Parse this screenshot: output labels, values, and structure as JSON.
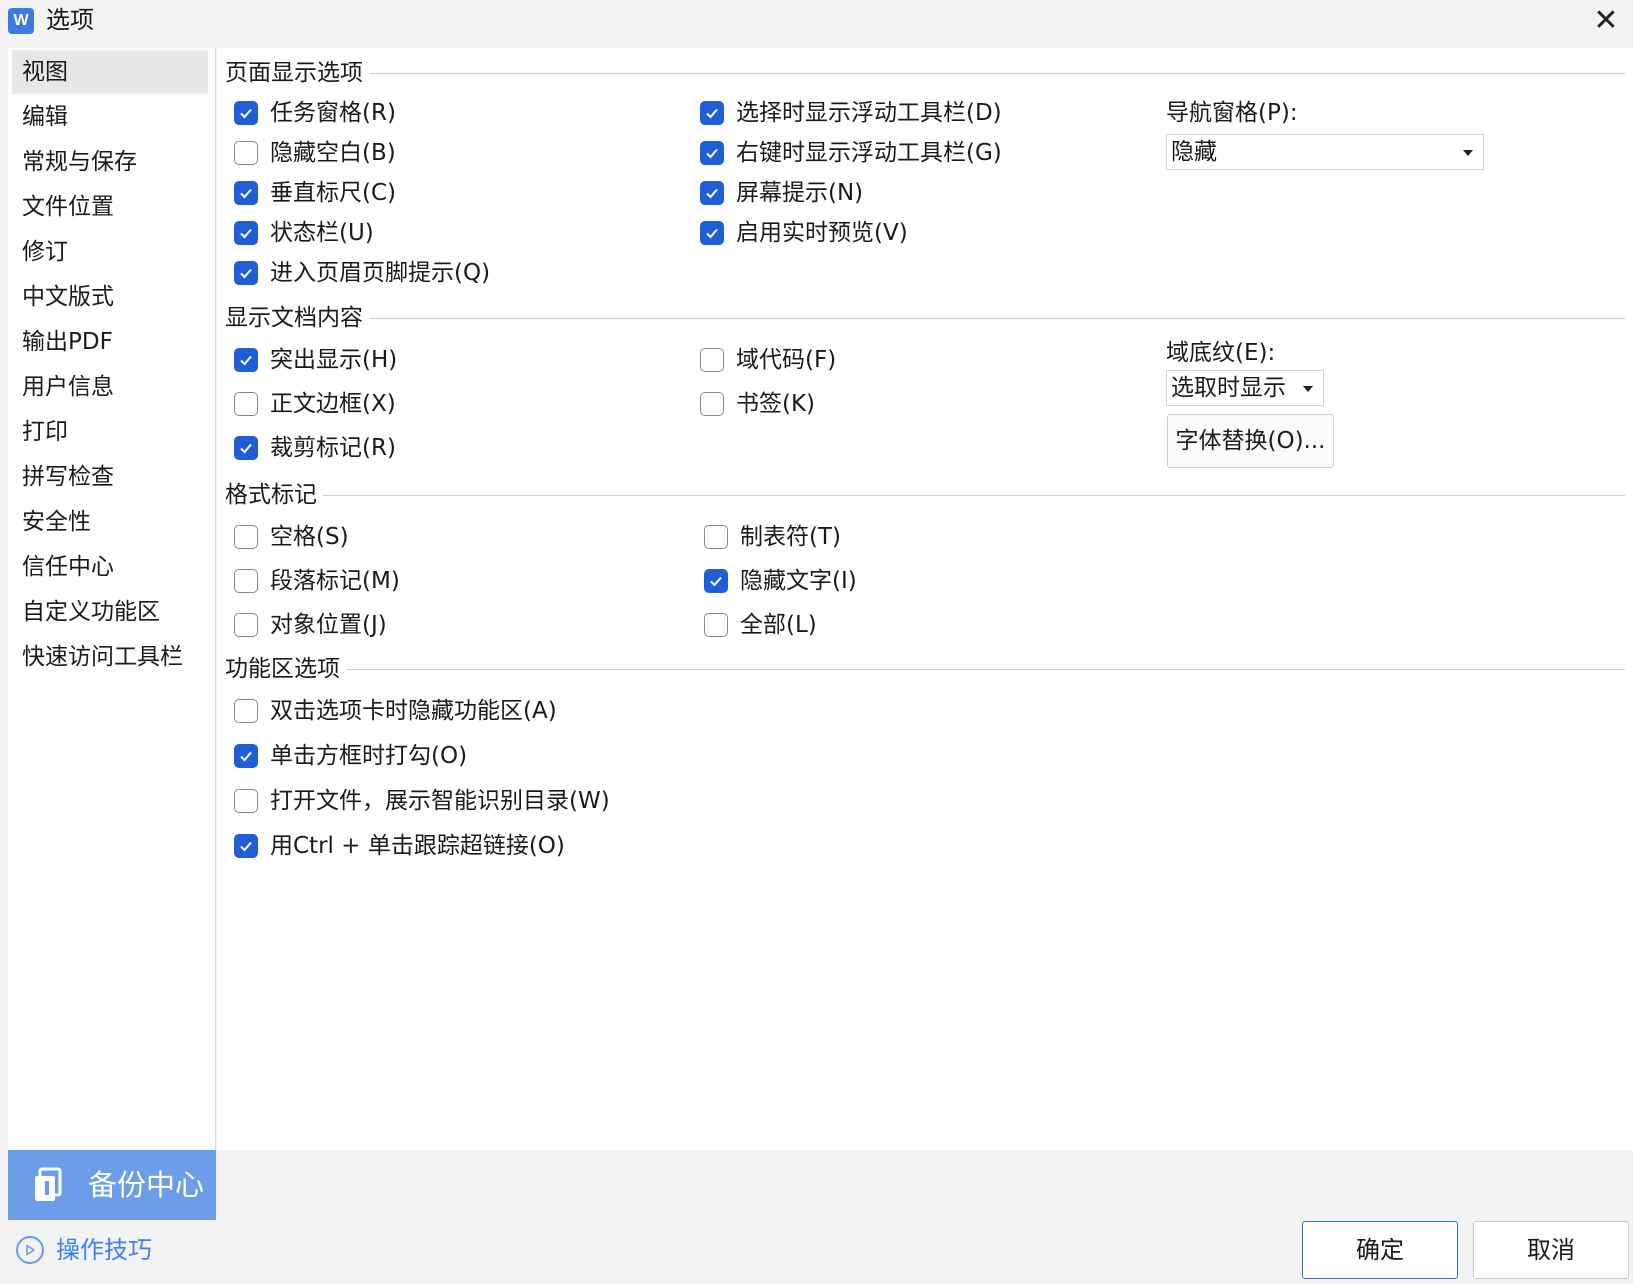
{
  "window": {
    "title": "选项",
    "app_icon_letter": "W"
  },
  "sidebar": {
    "items": [
      "视图",
      "编辑",
      "常规与保存",
      "文件位置",
      "修订",
      "中文版式",
      "输出PDF",
      "用户信息",
      "打印",
      "拼写检查",
      "安全性",
      "信任中心",
      "自定义功能区",
      "快速访问工具栏"
    ],
    "active_index": 0
  },
  "page_display": {
    "title": "页面显示选项",
    "col1": [
      {
        "label": "任务窗格(R)",
        "checked": true
      },
      {
        "label": "隐藏空白(B)",
        "checked": false
      },
      {
        "label": "垂直标尺(C)",
        "checked": true
      },
      {
        "label": "状态栏(U)",
        "checked": true
      },
      {
        "label": "进入页眉页脚提示(Q)",
        "checked": true
      }
    ],
    "col2": [
      {
        "label": "选择时显示浮动工具栏(D)",
        "checked": true
      },
      {
        "label": "右键时显示浮动工具栏(G)",
        "checked": true
      },
      {
        "label": "屏幕提示(N)",
        "checked": true
      },
      {
        "label": "启用实时预览(V)",
        "checked": true
      }
    ],
    "nav_pane_label": "导航窗格(P):",
    "nav_pane_value": "隐藏"
  },
  "doc_content": {
    "title": "显示文档内容",
    "col1": [
      {
        "label": "突出显示(H)",
        "checked": true
      },
      {
        "label": "正文边框(X)",
        "checked": false
      },
      {
        "label": "裁剪标记(R)",
        "checked": true
      }
    ],
    "col2": [
      {
        "label": "域代码(F)",
        "checked": false
      },
      {
        "label": "书签(K)",
        "checked": false
      }
    ],
    "field_shading_label": "域底纹(E):",
    "field_shading_value": "选取时显示",
    "font_sub_button": "字体替换(O)..."
  },
  "format_marks": {
    "title": "格式标记",
    "col1": [
      {
        "label": "空格(S)",
        "checked": false
      },
      {
        "label": "段落标记(M)",
        "checked": false
      },
      {
        "label": "对象位置(J)",
        "checked": false
      }
    ],
    "col2": [
      {
        "label": "制表符(T)",
        "checked": false
      },
      {
        "label": "隐藏文字(I)",
        "checked": true
      },
      {
        "label": "全部(L)",
        "checked": false
      }
    ]
  },
  "ribbon": {
    "title": "功能区选项",
    "col1": [
      {
        "label": "双击选项卡时隐藏功能区(A)",
        "checked": false
      },
      {
        "label": "单击方框时打勾(O)",
        "checked": true
      },
      {
        "label": "打开文件，展示智能识别目录(W)",
        "checked": false
      },
      {
        "label": "用Ctrl + 单击跟踪超链接(O)",
        "checked": true
      }
    ]
  },
  "footer": {
    "backup_label": "备份中心",
    "tips_label": "操作技巧",
    "ok_label": "确定",
    "cancel_label": "取消"
  },
  "colors": {
    "accent": "#1f5ed6",
    "backup_bg": "#6b9de9",
    "link": "#3b82f0"
  }
}
